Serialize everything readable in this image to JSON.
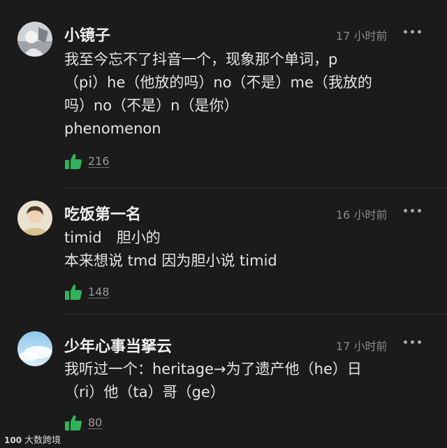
{
  "comments": [
    {
      "username": "小镜子",
      "time": "17 小时前",
      "lines": [
        "我至今忘不了抖音一个，现象那个单词，p",
        "（pi）he（他放的吗）no（不是）me（我放的",
        "吗）no（不是）n（是你）",
        "phenomenon"
      ],
      "likes": "216"
    },
    {
      "username": "吃饭第一名",
      "time": "16 小时前",
      "lines": [
        "timid　胆小的",
        "本来想说 tmd 因为胆小说 timid"
      ],
      "likes": "148"
    },
    {
      "username": "少年心事当拏云",
      "time": "17 小时前",
      "lines": [
        "我听过一个：heritage→为了遗产他（he）日",
        "（ri）他（ta）哥（ge）"
      ],
      "likes": "80"
    }
  ],
  "watermark": {
    "logo": "100",
    "text": "大数跨境"
  },
  "colors": {
    "background": "#1b1b1b",
    "like_green": "#2fb35a"
  },
  "icons": {
    "more": "more-horizontal-icon",
    "like": "thumbs-up-icon"
  }
}
